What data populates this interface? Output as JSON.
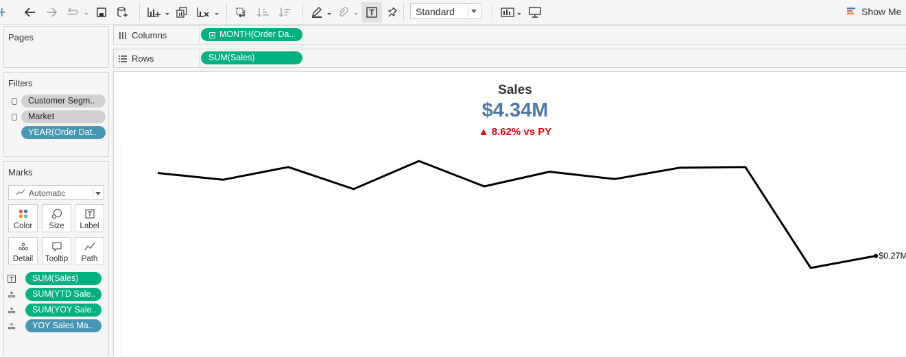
{
  "toolbar": {
    "fit_value": "Standard",
    "show_me_label": "Show Me",
    "icons": [
      "tableau-icon",
      "undo-icon",
      "redo-icon",
      "replay-icon",
      "save-icon",
      "new-datasource-icon",
      "new-worksheet-icon",
      "duplicate-icon",
      "clear-sheet-icon",
      "swap-icon",
      "sort-ascending-icon",
      "sort-descending-icon",
      "highlight-icon",
      "group-icon",
      "show-labels-icon",
      "pin-icon",
      "presentation-icon",
      "show-cards-icon"
    ]
  },
  "panels": {
    "pages_title": "Pages",
    "filters_title": "Filters",
    "filters": [
      {
        "label": "Customer Segm..",
        "style": "gray"
      },
      {
        "label": "Market",
        "style": "gray"
      },
      {
        "label": "YEAR(Order Dat..",
        "style": "blue"
      }
    ],
    "marks_title": "Marks",
    "mark_type": "Automatic",
    "mark_cards": [
      "Color",
      "Size",
      "Label",
      "Detail",
      "Tooltip",
      "Path"
    ],
    "mark_fields": [
      {
        "label": "SUM(Sales)",
        "style": "green",
        "icon": "label-icon"
      },
      {
        "label": "SUM(YTD Sale..",
        "style": "green",
        "icon": "detail-icon"
      },
      {
        "label": "SUM(YOY Sale..",
        "style": "green",
        "icon": "detail-icon"
      },
      {
        "label": "YOY  Sales Ma..",
        "style": "blue",
        "icon": "detail-icon"
      }
    ]
  },
  "shelves": {
    "columns_label": "Columns",
    "columns_pill": "MONTH(Order Da..",
    "rows_label": "Rows",
    "rows_pill": "SUM(Sales)"
  },
  "viz": {
    "title": "Sales",
    "total": "$4.34M",
    "yoy": "▲ 8.62% vs PY",
    "accent_color": "#4e79a7",
    "yoy_color": "#e8000b"
  },
  "chart_data": {
    "type": "line",
    "x": [
      1,
      2,
      3,
      4,
      5,
      6,
      7,
      8,
      9,
      10,
      11,
      12
    ],
    "values": [
      0.394,
      0.384,
      0.403,
      0.37,
      0.412,
      0.374,
      0.396,
      0.385,
      0.402,
      0.403,
      0.252,
      0.27
    ],
    "end_label": "$0.27M",
    "line_color": "#000000",
    "grid": false
  }
}
